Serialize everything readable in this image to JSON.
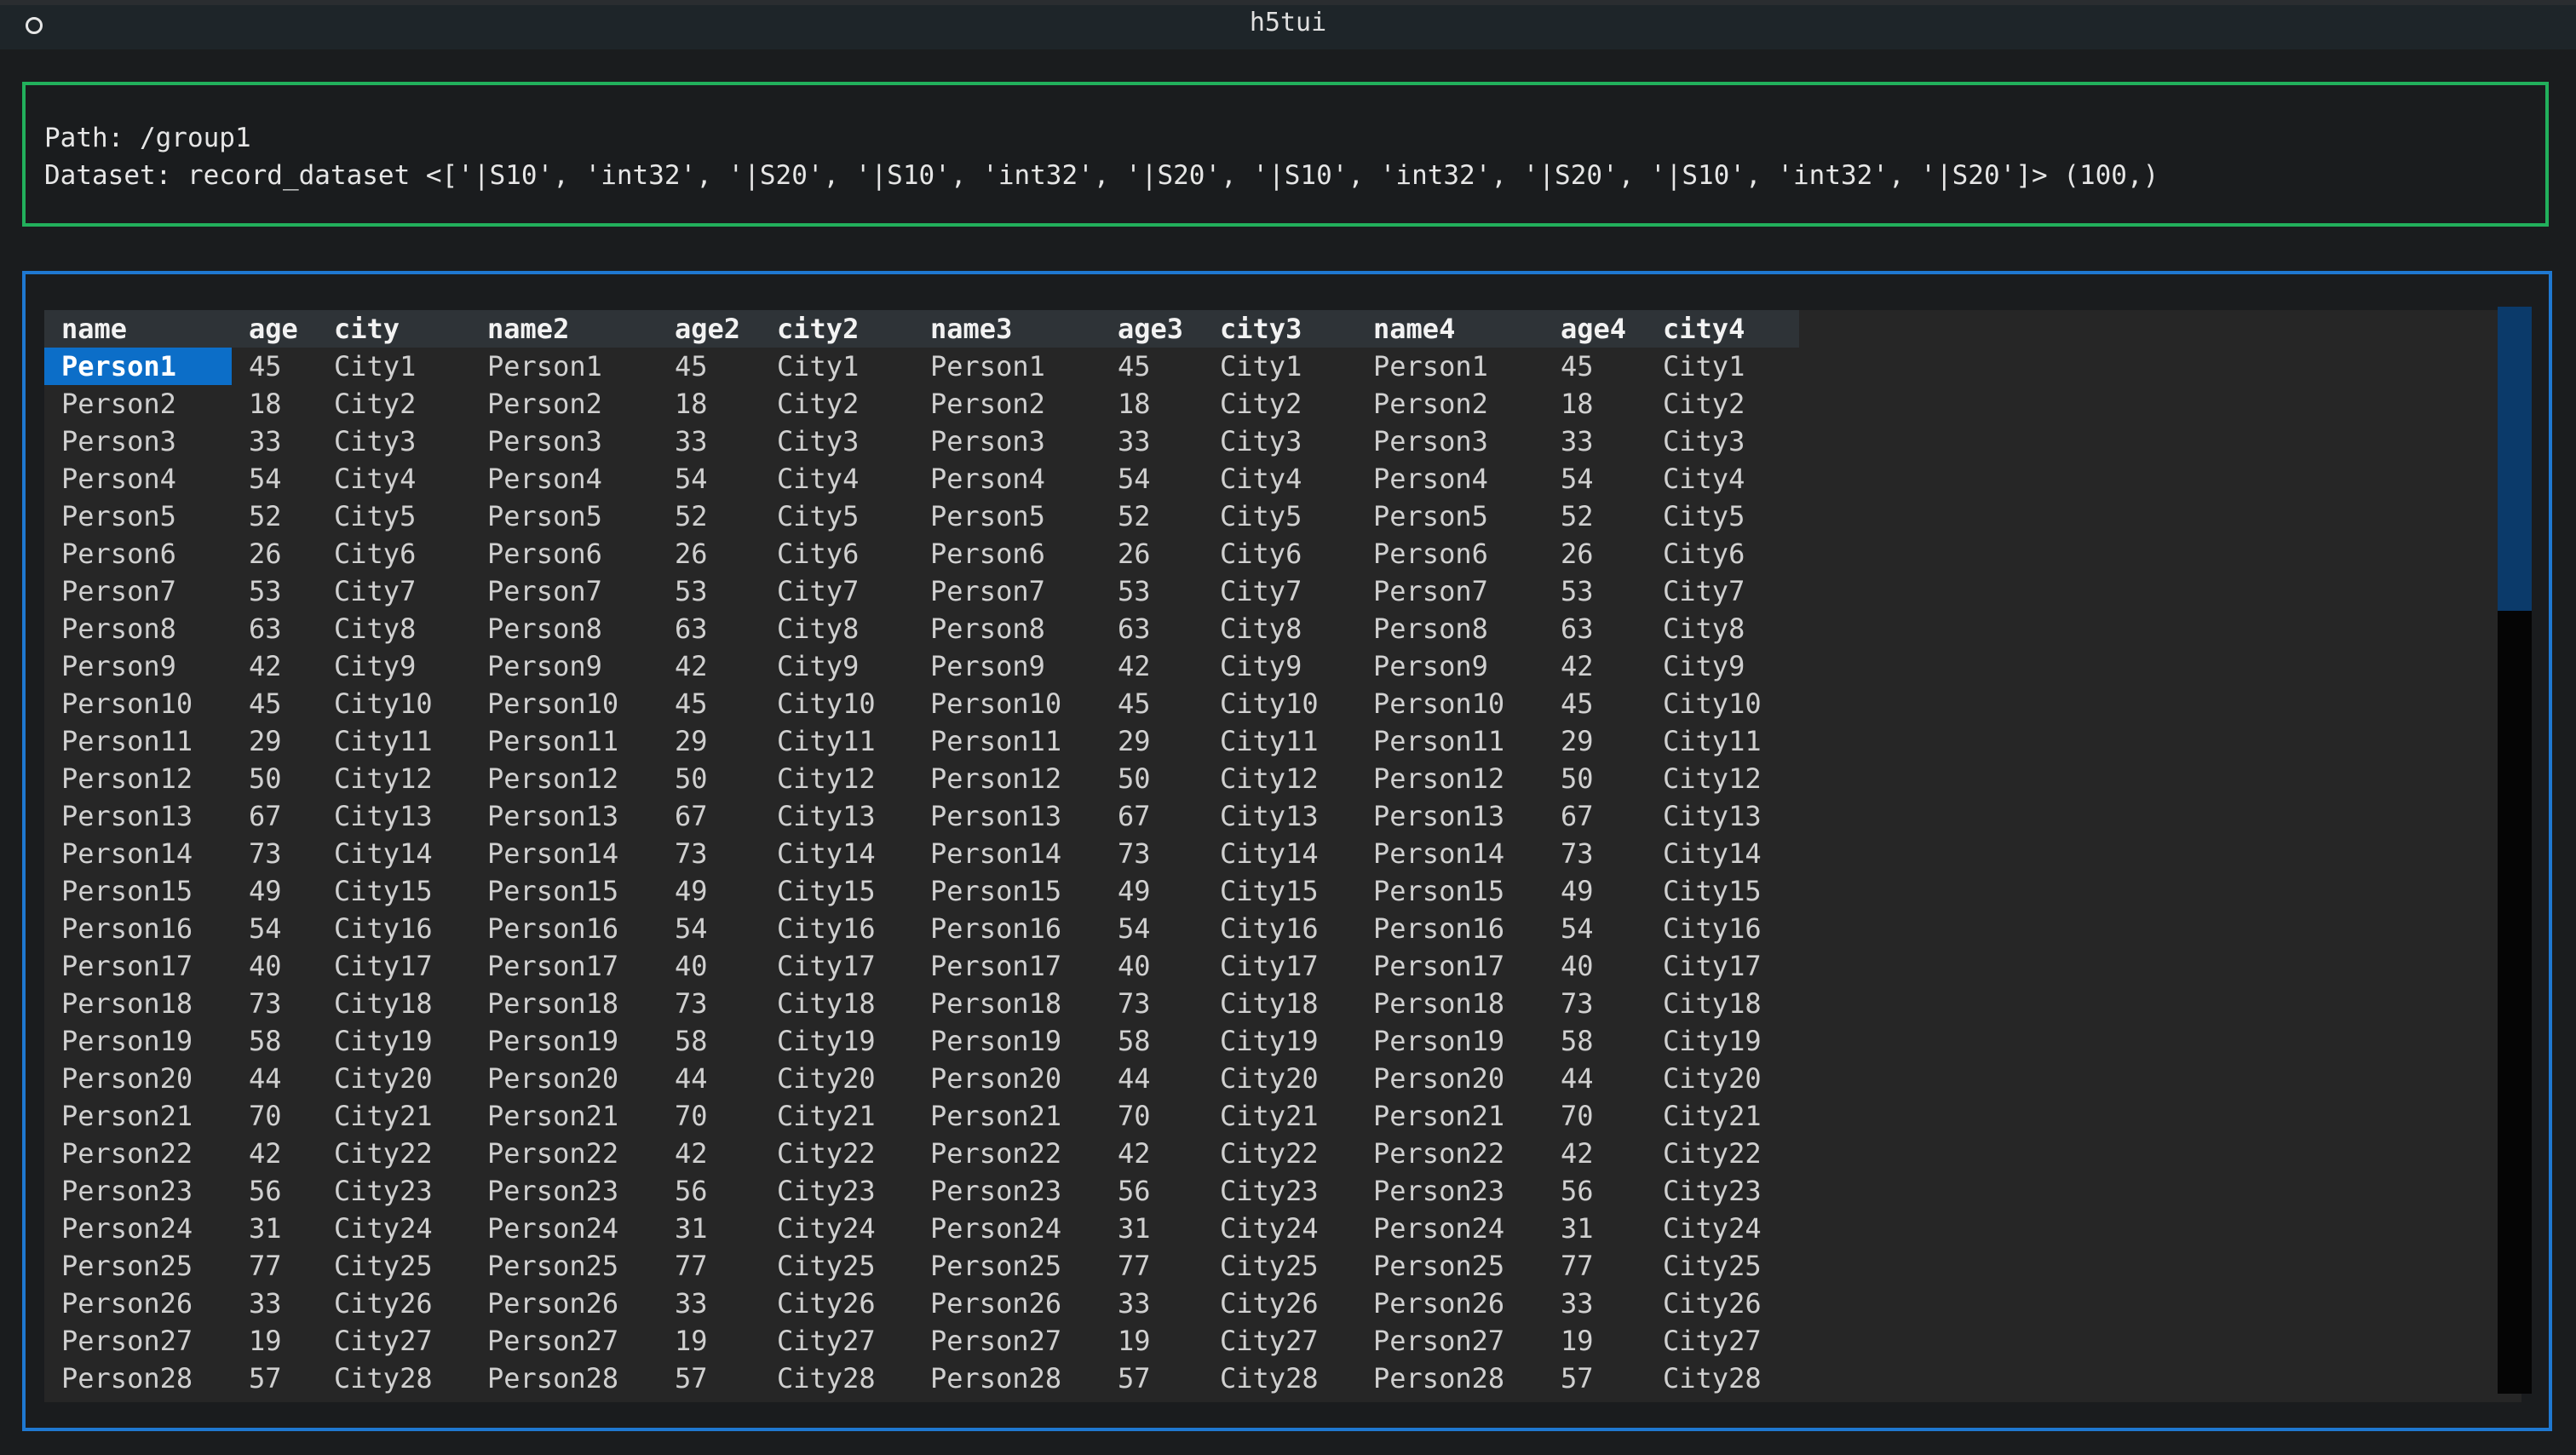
{
  "window": {
    "title": "h5tui"
  },
  "info": {
    "path_line": "Path: /group1",
    "dataset_line": "Dataset: record_dataset <['|S10', 'int32', '|S20', '|S10', 'int32', '|S20', '|S10', 'int32', '|S20', '|S10', 'int32', '|S20']> (100,)"
  },
  "table": {
    "columns": [
      "name",
      "age",
      "city",
      "name2",
      "age2",
      "city2",
      "name3",
      "age3",
      "city3",
      "name4",
      "age4",
      "city4"
    ],
    "rows": [
      [
        "Person1",
        "45",
        "City1"
      ],
      [
        "Person2",
        "18",
        "City2"
      ],
      [
        "Person3",
        "33",
        "City3"
      ],
      [
        "Person4",
        "54",
        "City4"
      ],
      [
        "Person5",
        "52",
        "City5"
      ],
      [
        "Person6",
        "26",
        "City6"
      ],
      [
        "Person7",
        "53",
        "City7"
      ],
      [
        "Person8",
        "63",
        "City8"
      ],
      [
        "Person9",
        "42",
        "City9"
      ],
      [
        "Person10",
        "45",
        "City10"
      ],
      [
        "Person11",
        "29",
        "City11"
      ],
      [
        "Person12",
        "50",
        "City12"
      ],
      [
        "Person13",
        "67",
        "City13"
      ],
      [
        "Person14",
        "73",
        "City14"
      ],
      [
        "Person15",
        "49",
        "City15"
      ],
      [
        "Person16",
        "54",
        "City16"
      ],
      [
        "Person17",
        "40",
        "City17"
      ],
      [
        "Person18",
        "73",
        "City18"
      ],
      [
        "Person19",
        "58",
        "City19"
      ],
      [
        "Person20",
        "44",
        "City20"
      ],
      [
        "Person21",
        "70",
        "City21"
      ],
      [
        "Person22",
        "42",
        "City22"
      ],
      [
        "Person23",
        "56",
        "City23"
      ],
      [
        "Person24",
        "31",
        "City24"
      ],
      [
        "Person25",
        "77",
        "City25"
      ],
      [
        "Person26",
        "33",
        "City26"
      ],
      [
        "Person27",
        "19",
        "City27"
      ],
      [
        "Person28",
        "57",
        "City28"
      ]
    ],
    "selected_row": 0,
    "selected_col": 0
  },
  "scrollbar": {
    "position_fraction": 0.0,
    "visible_fraction": 0.28
  },
  "colors": {
    "info_border": "#22b05c",
    "table_border": "#1f78d1",
    "selection": "#0c6ec8"
  }
}
